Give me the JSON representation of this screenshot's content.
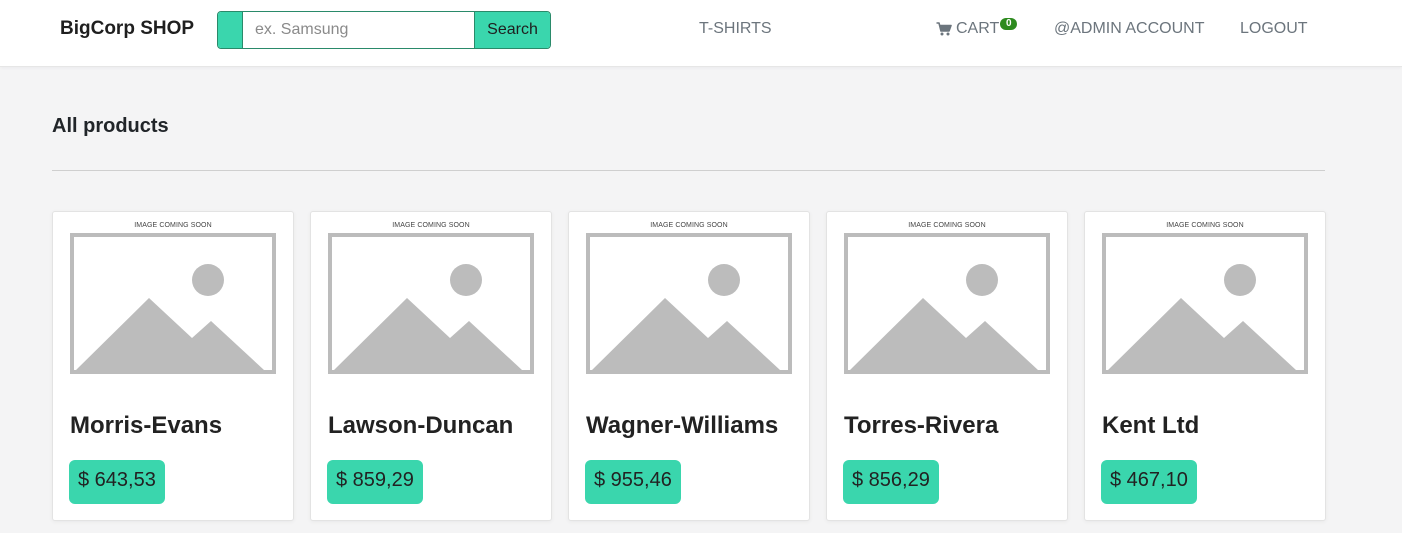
{
  "navbar": {
    "brand": "BigCorp SHOP",
    "search": {
      "placeholder": "ex. Samsung",
      "value": "",
      "button_label": "Search"
    },
    "links": {
      "tshirts": "T-SHIRTS",
      "cart": "CART",
      "cart_count": "0",
      "admin": "@ADMIN ACCOUNT",
      "logout": "LOGOUT"
    }
  },
  "colors": {
    "accent": "#3ad6ad",
    "badge": "#2e8b1f"
  },
  "section": {
    "title": "All products"
  },
  "products": [
    {
      "name": "Morris-Evans",
      "price": "$ 643,53",
      "image_caption": "IMAGE COMING SOON"
    },
    {
      "name": "Lawson-Duncan",
      "price": "$ 859,29",
      "image_caption": "IMAGE COMING SOON"
    },
    {
      "name": "Wagner-Williams",
      "price": "$ 955,46",
      "image_caption": "IMAGE COMING SOON"
    },
    {
      "name": "Torres-Rivera",
      "price": "$ 856,29",
      "image_caption": "IMAGE COMING SOON"
    },
    {
      "name": "Kent Ltd",
      "price": "$ 467,10",
      "image_caption": "IMAGE COMING SOON"
    }
  ]
}
